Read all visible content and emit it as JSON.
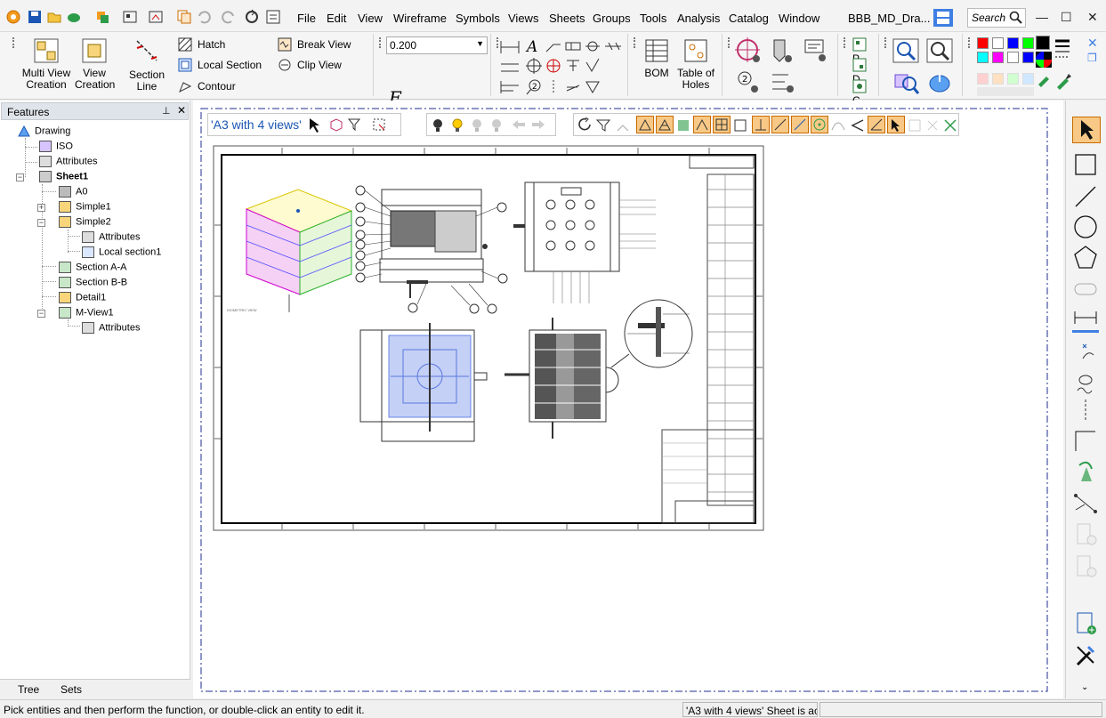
{
  "app": {
    "document_title": "BBB_MD_Dra..."
  },
  "menu": {
    "items": [
      "File",
      "Edit",
      "View",
      "Wireframe",
      "Symbols",
      "Views",
      "Sheets",
      "Groups",
      "Tools",
      "Analysis",
      "Catalog",
      "Window"
    ],
    "search_placeholder": "Search"
  },
  "ribbon": {
    "multi_view": "Multi View\nCreation",
    "multi_view_l1": "Multi View",
    "multi_view_l2": "Creation",
    "view_creation_l1": "View",
    "view_creation_l2": "Creation",
    "section_line": "Section Line",
    "hatch": "Hatch",
    "local_section": "Local Section",
    "contour": "Contour",
    "break_view": "Break View",
    "clip_view": "Clip View",
    "dimension_value": "0.200",
    "font_symbol": "F",
    "bom": "BOM",
    "table_of_holes_l1": "Table of",
    "table_of_holes_l2": "Holes",
    "partial_labels": [
      "P",
      "D",
      "C"
    ]
  },
  "colors": {
    "palette_row1": [
      "#ff0000",
      "#ffffff",
      "#0000ff",
      "#00ff00",
      "#000000"
    ],
    "palette_row2": [
      "#00ffff",
      "#ff00ff",
      "#ffffff",
      "#0000ff",
      "#000000"
    ],
    "palette_row3": [
      "#ffd0d0",
      "#ffe0c0",
      "#d0ffd0",
      "#d0e8ff",
      "#e8e8e8"
    ],
    "accent_blue": "#1a56b3",
    "sheet_border": "#1f2f8f"
  },
  "features": {
    "header": "Features",
    "tree": [
      {
        "label": "Drawing",
        "level": 0
      },
      {
        "label": "ISO",
        "level": 1
      },
      {
        "label": "Attributes",
        "level": 1
      },
      {
        "label": "Sheet1",
        "level": 1
      },
      {
        "label": "A0",
        "level": 2
      },
      {
        "label": "Simple1",
        "level": 2
      },
      {
        "label": "Simple2",
        "level": 2
      },
      {
        "label": "Attributes",
        "level": 3
      },
      {
        "label": "Local section1",
        "level": 3
      },
      {
        "label": "Section A-A",
        "level": 2
      },
      {
        "label": "Section B-B",
        "level": 2
      },
      {
        "label": "Detail1",
        "level": 2
      },
      {
        "label": "M-View1",
        "level": 2
      },
      {
        "label": "Attributes",
        "level": 3
      }
    ],
    "tabs": [
      "Tree",
      "Sets"
    ]
  },
  "canvas": {
    "sheet_label": "'A3 with 4 views'"
  },
  "status": {
    "hint": "Pick entities and then perform the function, or double-click an entity to edit it.",
    "sheet_state": "'A3 with 4 views' Sheet is ac"
  }
}
